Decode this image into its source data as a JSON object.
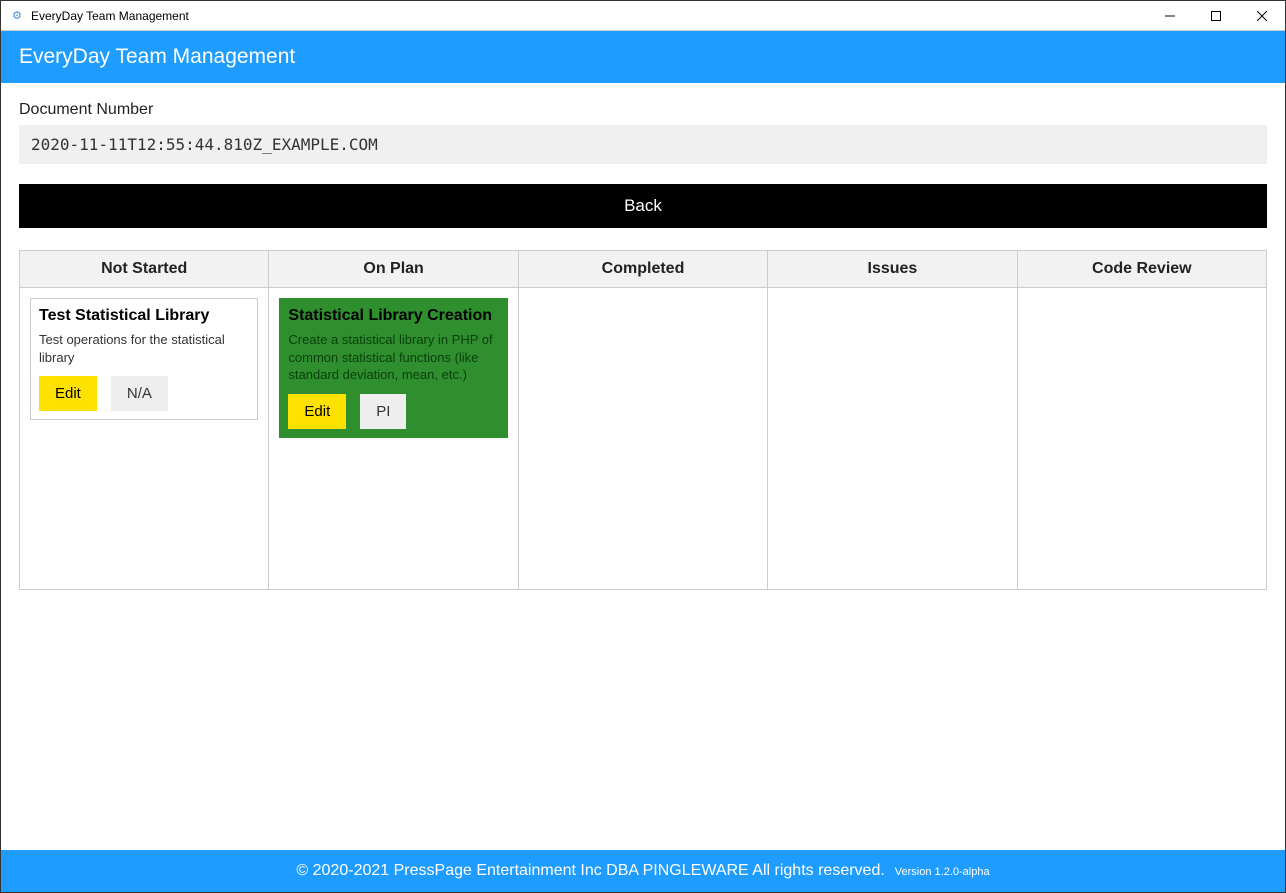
{
  "window": {
    "title": "EveryDay Team Management"
  },
  "header": {
    "title": "EveryDay Team Management"
  },
  "document": {
    "label": "Document Number",
    "value": "2020-11-11T12:55:44.810Z_EXAMPLE.COM"
  },
  "back_button": "Back",
  "columns": [
    {
      "label": "Not Started"
    },
    {
      "label": "On Plan"
    },
    {
      "label": "Completed"
    },
    {
      "label": "Issues"
    },
    {
      "label": "Code Review"
    }
  ],
  "cards": {
    "not_started": {
      "title": "Test Statistical Library",
      "desc": "Test operations for the statistical library",
      "edit": "Edit",
      "secondary": "N/A"
    },
    "on_plan": {
      "title": "Statistical Library Creation",
      "desc": "Create a statistical library in PHP of common statistical functions (like standard deviation, mean, etc.)",
      "edit": "Edit",
      "secondary": "PI"
    }
  },
  "footer": {
    "copyright": "© 2020-2021 PressPage Entertainment Inc DBA PINGLEWARE  All rights reserved.",
    "version": "Version 1.2.0-alpha"
  }
}
